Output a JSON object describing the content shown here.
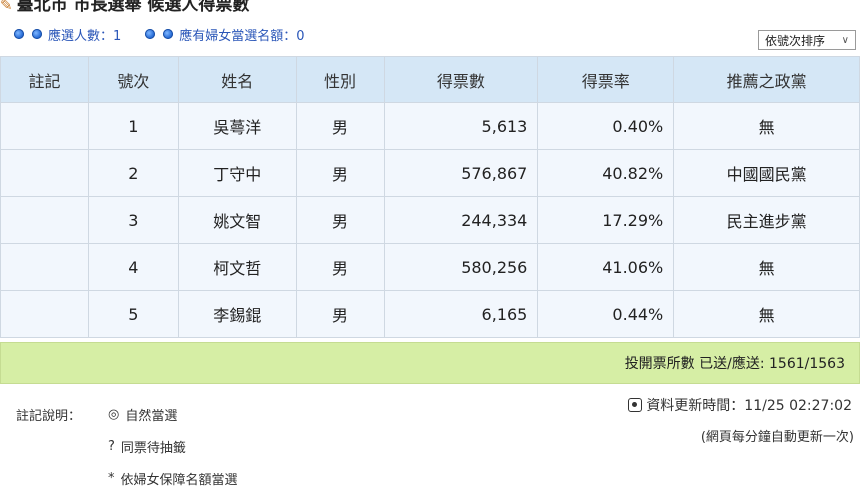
{
  "header": {
    "title": "臺北市 市長選舉 候選人得票數"
  },
  "info": {
    "elected_count": "應選人數：1",
    "women_quota": "應有婦女當選名額：0"
  },
  "sort": {
    "selected": "依號次排序"
  },
  "table": {
    "columns": [
      "註記",
      "號次",
      "姓名",
      "性別",
      "得票數",
      "得票率",
      "推薦之政黨"
    ],
    "rows": [
      {
        "note": "",
        "no": "1",
        "name": "吳蕚洋",
        "gender": "男",
        "votes": "5,613",
        "rate": "0.40%",
        "party": "無"
      },
      {
        "note": "",
        "no": "2",
        "name": "丁守中",
        "gender": "男",
        "votes": "576,867",
        "rate": "40.82%",
        "party": "中國國民黨"
      },
      {
        "note": "",
        "no": "3",
        "name": "姚文智",
        "gender": "男",
        "votes": "244,334",
        "rate": "17.29%",
        "party": "民主進步黨"
      },
      {
        "note": "",
        "no": "4",
        "name": "柯文哲",
        "gender": "男",
        "votes": "580,256",
        "rate": "41.06%",
        "party": "無"
      },
      {
        "note": "",
        "no": "5",
        "name": "李錫錕",
        "gender": "男",
        "votes": "6,165",
        "rate": "0.44%",
        "party": "無"
      }
    ]
  },
  "summary": {
    "stations": "投開票所數 已送/應送: 1561/1563"
  },
  "legend": {
    "label": "註記說明：",
    "items": [
      {
        "symbol": "◎",
        "text": "自然當選"
      },
      {
        "symbol": "?",
        "text": "同票待抽籤"
      },
      {
        "symbol": "*",
        "text": "依婦女保障名額當選"
      }
    ]
  },
  "update": {
    "time": "資料更新時間：11/25 02:27:02",
    "note": "(網頁每分鐘自動更新一次)"
  },
  "colors": {
    "header_bg": "#d5e7f6",
    "row_bg": "#f2f7fd",
    "summary_bg": "#d6eea5",
    "link_blue": "#2a56b8"
  }
}
